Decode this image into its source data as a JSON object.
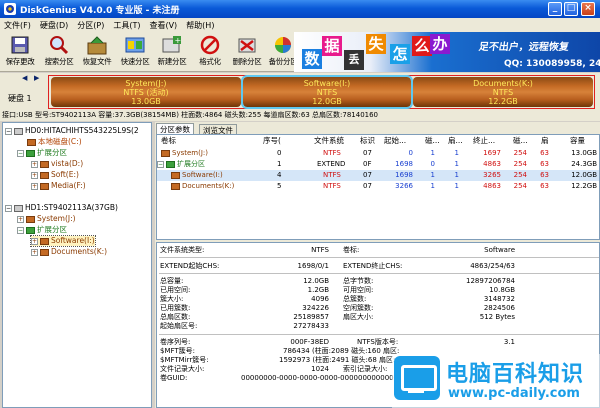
{
  "window": {
    "title": "DiskGenius V4.0.0 专业版 - 未注册"
  },
  "menu": [
    "文件(F)",
    "硬盘(D)",
    "分区(P)",
    "工具(T)",
    "查看(V)",
    "帮助(H)"
  ],
  "toolbar": [
    "保存更改",
    "搜索分区",
    "恢复文件",
    "快速分区",
    "新建分区",
    "格式化",
    "删除分区",
    "备份分区"
  ],
  "banner": {
    "chars": [
      "数",
      "据",
      "丢",
      "失",
      "怎",
      "么",
      "办"
    ],
    "slogan": "足不出户，远程恢复",
    "qq": "QQ: 130089958, 2433"
  },
  "disk": {
    "label": "硬盘 1",
    "segments": [
      {
        "name": "System(J:)",
        "fs": "NTFS (活动)",
        "size": "13.0GB"
      },
      {
        "name": "Software(I:)",
        "fs": "NTFS",
        "size": "12.0GB"
      },
      {
        "name": "Documents(K:)",
        "fs": "NTFS",
        "size": "12.2GB"
      }
    ],
    "info": "接口:USB   型号:ST9402113A   容量:37.3GB(38154MB)   柱面数:4864   磁头数:255   每道扇区数:63   总扇区数:78140160"
  },
  "tree": [
    {
      "text": "HD0:HITACHIHTS543225L9S(2"
    },
    {
      "text": "本地磁盘(C:)"
    },
    {
      "text": "扩展分区"
    },
    {
      "text": "vista(D:)"
    },
    {
      "text": "Soft(E:)"
    },
    {
      "text": "Media(F:)"
    },
    {
      "text": "HD1:ST9402113A(37GB)"
    },
    {
      "text": "System(J:)"
    },
    {
      "text": "扩展分区"
    },
    {
      "text": "Software(I:)"
    },
    {
      "text": "Documents(K:)"
    }
  ],
  "tabs": [
    "分区参数",
    "浏览文件"
  ],
  "table": {
    "headers": [
      "卷标",
      "序号(",
      "文件系统",
      "标识",
      "起始...",
      "磁...",
      "扇...",
      "终止...",
      "磁...",
      "扇",
      "容量"
    ],
    "rows": [
      {
        "name": "System(J:)",
        "idx": "0",
        "fs": "NTFS",
        "id": "07",
        "c1": "0",
        "h1": "1",
        "s1": "1",
        "c2": "1697",
        "h2": "254",
        "s2": "63",
        "cap": "13.0GB"
      },
      {
        "name": "扩展分区",
        "idx": "1",
        "fs": "EXTEND",
        "id": "0F",
        "c1": "1698",
        "h1": "0",
        "s1": "1",
        "c2": "4863",
        "h2": "254",
        "s2": "63",
        "cap": "24.3GB"
      },
      {
        "name": "Software(I:)",
        "idx": "4",
        "fs": "NTFS",
        "id": "07",
        "c1": "1698",
        "h1": "1",
        "s1": "1",
        "c2": "3265",
        "h2": "254",
        "s2": "63",
        "cap": "12.0GB"
      },
      {
        "name": "Documents(K:)",
        "idx": "5",
        "fs": "NTFS",
        "id": "07",
        "c1": "3266",
        "h1": "1",
        "s1": "1",
        "c2": "4863",
        "h2": "254",
        "s2": "63",
        "cap": "12.2GB"
      }
    ]
  },
  "details": {
    "fs_type_label": "文件系统类型:",
    "fs_type": "NTFS",
    "vol_label": "卷标:",
    "vol": "Software",
    "ext_start_label": "EXTEND起始CHS:",
    "ext_start": "1698/0/1",
    "ext_end_label": "EXTEND终止CHS:",
    "ext_end": "4863/254/63",
    "total_cap_label": "总容量:",
    "total_cap": "12.0GB",
    "total_bytes_label": "总字节数:",
    "total_bytes": "12897206784",
    "used_label": "已用空间:",
    "used": "1.2GB",
    "free_label": "可用空间:",
    "free": "10.8GB",
    "cluster_label": "簇大小:",
    "cluster": "4096",
    "total_clusters_label": "总簇数:",
    "total_clusters": "3148732",
    "used_clusters_label": "已用簇数:",
    "used_clusters": "324226",
    "free_clusters_label": "空闲簇数:",
    "free_clusters": "2824506",
    "total_sectors_label": "总扇区数:",
    "total_sectors": "25189857",
    "sector_size_label": "扇区大小:",
    "sector_size": "512 Bytes",
    "start_sector_label": "起始扇区号:",
    "start_sector": "27278433",
    "serial_label": "卷序列号:",
    "serial": "000F-38ED",
    "ntfs_ver_label": "NTFS版本号:",
    "ntfs_ver": "3.1",
    "mft_label": "$MFT簇号:",
    "mft": "786434 (柱面:2089 磁头:160 扇区:",
    "mftmirr_label": "$MFTMirr簇号:",
    "mftmirr": "1592973 (柱面:2491 磁头:68 扇区:",
    "rec_size_label": "文件记录大小:",
    "rec_size": "1024",
    "idx_size_label": "索引记录大小:",
    "idx_size": "",
    "guid_label": "卷GUID:",
    "guid": "00000000-0000-0000-0000-000000000000"
  },
  "watermark": {
    "title": "电脑百科知识",
    "url": "www.pc-daily.com"
  }
}
